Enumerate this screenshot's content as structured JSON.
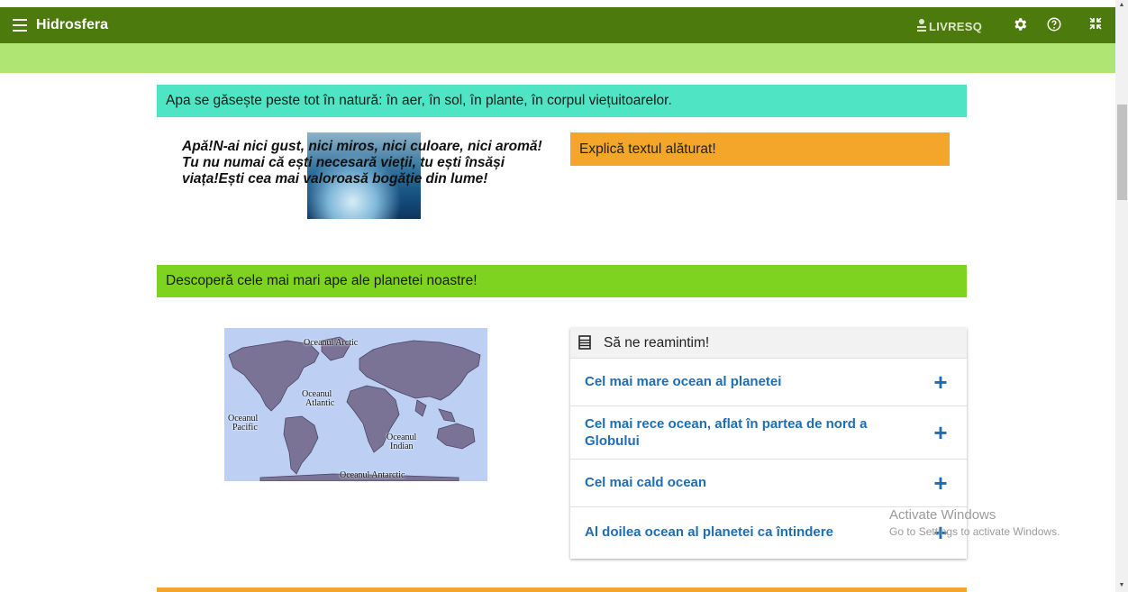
{
  "app": {
    "title": "Hidrosfera",
    "brand": "LIVRESQ"
  },
  "toolbar": {
    "menu_icon": "hamburger-menu-icon",
    "settings_icon": "gear-icon",
    "help_icon": "help-circle-icon",
    "fullscreen_icon": "collapse-fullscreen-icon"
  },
  "colors": {
    "topbar": "#4c7a0c",
    "subbar": "#aee573",
    "banner_teal": "#4fe4c4",
    "banner_green": "#7ed321",
    "orange": "#f4a62a",
    "link_blue": "#1f6db3"
  },
  "content": {
    "banner1": "Apa se găsește peste tot în natură: în aer, în sol, în plante, în corpul viețuitoarelor.",
    "quote": "Apă!N-ai nici gust, nici miros, nici culoare, nici aromă! Tu nu numai că ești necesară vieții, tu ești însăși viața!Ești cea mai valoroasă bogăție din lume!",
    "explain": "Explică textul alăturat!",
    "banner2": "Descoperă cele mai mari ape ale planetei noastre!"
  },
  "map": {
    "labels": {
      "arctic": "Oceanul Arctic",
      "atlantic_1": "Oceanul",
      "atlantic_2": "Atlantic",
      "pacific_1": "Oceanul",
      "pacific_2": "Pacific",
      "indian_1": "Oceanul",
      "indian_2": "Indian",
      "antarctic": "Oceanul Antarctic"
    }
  },
  "accordion": {
    "title": "Să ne reamintim!",
    "items": [
      {
        "label": "Cel mai mare ocean al planetei"
      },
      {
        "label": "Cel mai rece ocean, aflat în partea de nord a Globului"
      },
      {
        "label": "Cel mai cald ocean"
      },
      {
        "label": "Al doilea ocean al planetei ca întindere"
      }
    ],
    "expand_symbol": "+"
  },
  "watermark": {
    "line1": "Activate Windows",
    "line2": "Go to Settings to activate Windows."
  }
}
